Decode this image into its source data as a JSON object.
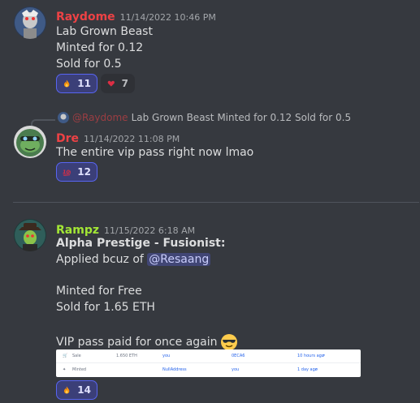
{
  "messages": [
    {
      "author": "Raydome",
      "author_color": "#ed4245",
      "timestamp": "11/14/2022 10:46 PM",
      "lines": [
        "Lab Grown Beast",
        "Minted for 0.12",
        "Sold for 0.5"
      ],
      "reactions": [
        {
          "emoji": "fire-emoji",
          "count": "11"
        },
        {
          "emoji": "heart-emoji",
          "count": "7"
        }
      ]
    },
    {
      "reply_to": {
        "author": "@Raydome",
        "text": "Lab Grown Beast Minted for 0.12 Sold for 0.5"
      },
      "author": "Dre",
      "author_color": "#ed4245",
      "timestamp": "11/14/2022 11:08 PM",
      "lines": [
        "The entire vip pass right now lmao"
      ],
      "reactions": [
        {
          "emoji": "hundred-emoji",
          "count": "12"
        }
      ]
    },
    {
      "author": "Rampz",
      "author_color": "#a3e635",
      "timestamp": "11/15/2022 6:18 AM",
      "title": "Alpha Prestige - Fusionist:",
      "applied_prefix": "Applied bcuz of",
      "mention": "@Resaang",
      "lines": [
        "Minted for Free",
        "Sold for 1.65 ETH",
        "VIP pass paid for once again"
      ],
      "trailing_emoji": "sunglasses-emoji",
      "embed": {
        "rows": [
          {
            "event": "Sale",
            "price": "1.650 ETH",
            "from": "you",
            "to": "0ECA6",
            "time": "10 hours ago"
          },
          {
            "event": "Minted",
            "price": "",
            "from": "NullAddress",
            "to": "you",
            "time": "1 day ago"
          }
        ]
      },
      "reactions": [
        {
          "emoji": "fire-emoji",
          "count": "14"
        }
      ]
    }
  ],
  "colors": {
    "background": "#36393f",
    "reaction_bg": "#3b3f78",
    "reaction_border": "#5865f2",
    "mention_bg": "#414675"
  }
}
